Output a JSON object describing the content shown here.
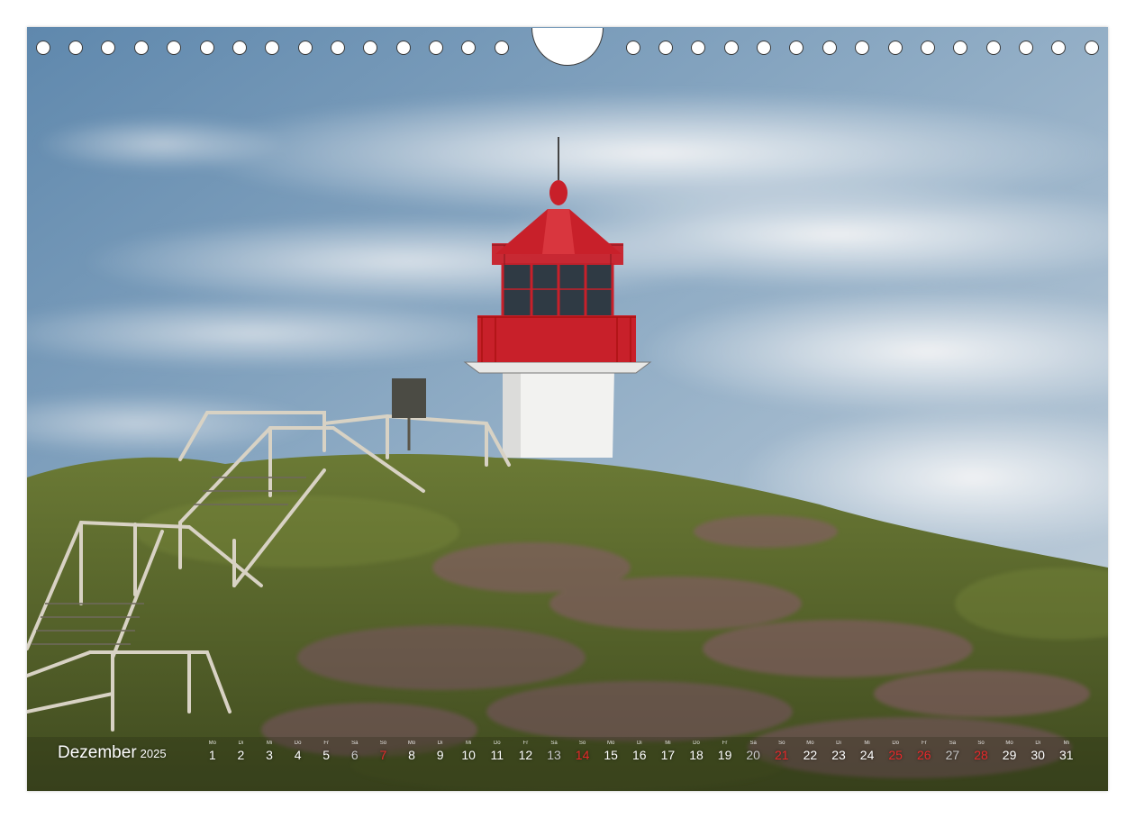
{
  "calendar": {
    "month": "Dezember",
    "year": "2025",
    "days": [
      {
        "wd": "Mo",
        "d": "1",
        "type": "wk"
      },
      {
        "wd": "Di",
        "d": "2",
        "type": "wk"
      },
      {
        "wd": "Mi",
        "d": "3",
        "type": "wk"
      },
      {
        "wd": "Do",
        "d": "4",
        "type": "wk"
      },
      {
        "wd": "Fr",
        "d": "5",
        "type": "wk"
      },
      {
        "wd": "Sa",
        "d": "6",
        "type": "sat"
      },
      {
        "wd": "So",
        "d": "7",
        "type": "sun"
      },
      {
        "wd": "Mo",
        "d": "8",
        "type": "wk"
      },
      {
        "wd": "Di",
        "d": "9",
        "type": "wk"
      },
      {
        "wd": "Mi",
        "d": "10",
        "type": "wk"
      },
      {
        "wd": "Do",
        "d": "11",
        "type": "wk"
      },
      {
        "wd": "Fr",
        "d": "12",
        "type": "wk"
      },
      {
        "wd": "Sa",
        "d": "13",
        "type": "sat"
      },
      {
        "wd": "So",
        "d": "14",
        "type": "sun"
      },
      {
        "wd": "Mo",
        "d": "15",
        "type": "wk"
      },
      {
        "wd": "Di",
        "d": "16",
        "type": "wk"
      },
      {
        "wd": "Mi",
        "d": "17",
        "type": "wk"
      },
      {
        "wd": "Do",
        "d": "18",
        "type": "wk"
      },
      {
        "wd": "Fr",
        "d": "19",
        "type": "wk"
      },
      {
        "wd": "Sa",
        "d": "20",
        "type": "sat"
      },
      {
        "wd": "So",
        "d": "21",
        "type": "sun"
      },
      {
        "wd": "Mo",
        "d": "22",
        "type": "wk"
      },
      {
        "wd": "Di",
        "d": "23",
        "type": "wk"
      },
      {
        "wd": "Mi",
        "d": "24",
        "type": "wk"
      },
      {
        "wd": "Do",
        "d": "25",
        "type": "sun"
      },
      {
        "wd": "Fr",
        "d": "26",
        "type": "sun"
      },
      {
        "wd": "Sa",
        "d": "27",
        "type": "sat"
      },
      {
        "wd": "So",
        "d": "28",
        "type": "sun"
      },
      {
        "wd": "Mo",
        "d": "29",
        "type": "wk"
      },
      {
        "wd": "Di",
        "d": "30",
        "type": "wk"
      },
      {
        "wd": "Mi",
        "d": "31",
        "type": "wk"
      }
    ]
  },
  "colors": {
    "sky_top": "#6f93b4",
    "cloud": "#e9ecef",
    "heath_green": "#5c6a2d",
    "heather_purple": "#8a5a6e",
    "lighthouse_red": "#c8202a",
    "lighthouse_white": "#f3f3f1",
    "sunday_red": "#e8282a"
  }
}
